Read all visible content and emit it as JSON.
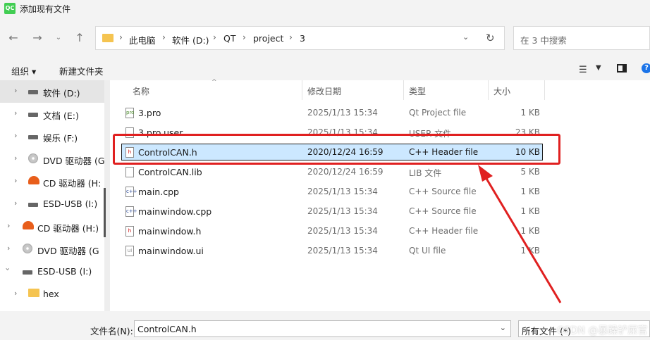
{
  "window": {
    "title": "添加现有文件",
    "app_icon_text": "QC"
  },
  "nav": {
    "breadcrumbs": [
      "此电脑",
      "软件 (D:)",
      "QT",
      "project",
      "3"
    ],
    "search_placeholder": "在 3 中搜索"
  },
  "toolbar": {
    "organize": "组织 ▾",
    "new_folder": "新建文件夹"
  },
  "sidebar": {
    "items": [
      {
        "label": "软件 (D:)",
        "icon": "drive-icon"
      },
      {
        "label": "文档 (E:)",
        "icon": "drive-icon"
      },
      {
        "label": "娱乐 (F:)",
        "icon": "drive-icon"
      },
      {
        "label": "DVD 驱动器 (G",
        "icon": "dvd-icon"
      },
      {
        "label": "CD 驱动器 (H:",
        "icon": "cd-icon"
      },
      {
        "label": "ESD-USB (I:)",
        "icon": "drive-icon"
      },
      {
        "label": "CD 驱动器 (H:)",
        "icon": "cd-icon"
      },
      {
        "label": "DVD 驱动器 (G",
        "icon": "dvd-icon"
      },
      {
        "label": "ESD-USB (I:)",
        "icon": "drive-icon"
      },
      {
        "label": "hex",
        "icon": "folder-icon"
      }
    ]
  },
  "columns": {
    "name": "名称",
    "date": "修改日期",
    "type": "类型",
    "size": "大小"
  },
  "files": [
    {
      "name": "3.pro",
      "date": "2025/1/13 15:34",
      "type": "Qt Project file",
      "size": "1 KB"
    },
    {
      "name": "3.pro.user",
      "date": "2025/1/13 15:34",
      "type": "USER 文件",
      "size": "23 KB"
    },
    {
      "name": "ControlCAN.h",
      "date": "2020/12/24 16:59",
      "type": "C++ Header file",
      "size": "10 KB"
    },
    {
      "name": "ControlCAN.lib",
      "date": "2020/12/24 16:59",
      "type": "LIB 文件",
      "size": "5 KB"
    },
    {
      "name": "main.cpp",
      "date": "2025/1/13 15:34",
      "type": "C++ Source file",
      "size": "1 KB"
    },
    {
      "name": "mainwindow.cpp",
      "date": "2025/1/13 15:34",
      "type": "C++ Source file",
      "size": "1 KB"
    },
    {
      "name": "mainwindow.h",
      "date": "2025/1/13 15:34",
      "type": "C++ Header file",
      "size": "1 KB"
    },
    {
      "name": "mainwindow.ui",
      "date": "2025/1/13 15:34",
      "type": "Qt UI file",
      "size": "1 KB"
    }
  ],
  "selected_index": 2,
  "bottom": {
    "filename_label": "文件名(N):",
    "filename_value": "ControlCAN.h",
    "filter_value": "所有文件 (*)"
  },
  "watermark": "CSDN @暴躁铲屎官",
  "colors": {
    "selection": "#cce8ff",
    "highlight_box": "#e02020",
    "arrow": "#e02020"
  }
}
